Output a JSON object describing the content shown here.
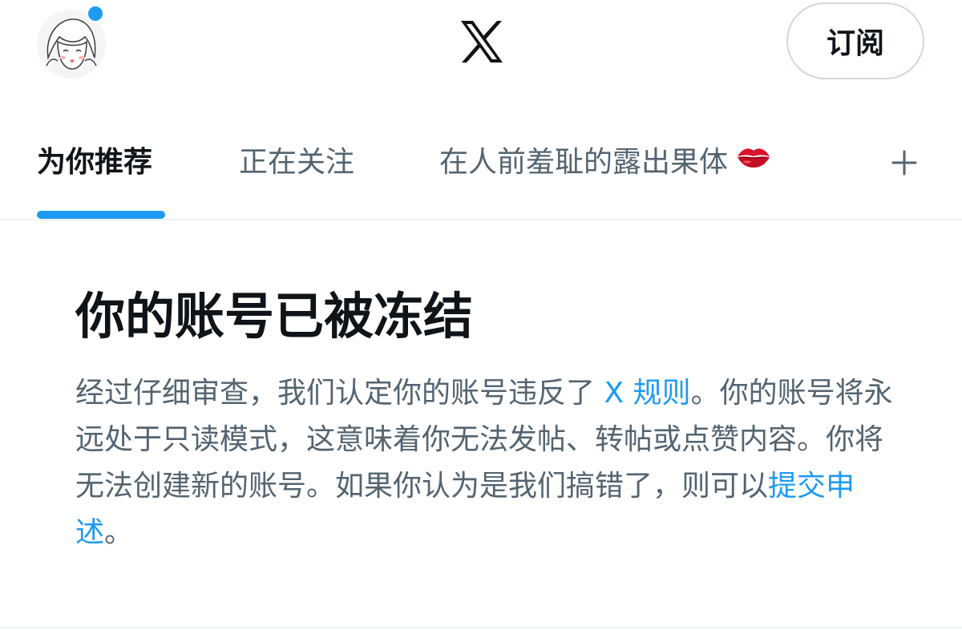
{
  "header": {
    "logo": "x-logo-icon",
    "subscribe_label": "订阅",
    "has_notification": true
  },
  "tabs": [
    {
      "label": "为你推荐",
      "active": true
    },
    {
      "label": "正在关注",
      "active": false
    },
    {
      "label": "在人前羞耻的露出果体",
      "emoji": "💋",
      "active": false
    }
  ],
  "notice": {
    "title": "你的账号已被冻结",
    "body_part1": "经过仔细审查，我们认定你的账号违反了 ",
    "rules_link": "X 规则",
    "body_part2": "。你的账号将永远处于只读模式，这意味着你无法发帖、转帖或点赞内容。你将无法创建新的账号。如果你认为是我们搞错了，则可以",
    "appeal_link": "提交申述",
    "body_part3": "。"
  },
  "colors": {
    "accent": "#1d9bf0",
    "text_primary": "#0f1419",
    "text_secondary": "#536471",
    "divider": "#eff3f4"
  }
}
